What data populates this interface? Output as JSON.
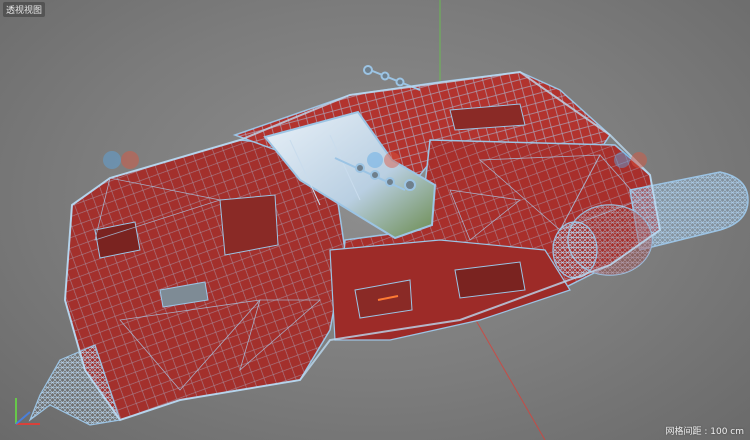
{
  "viewport": {
    "label": "透视视图",
    "grid_spacing": "网格间距 : 100 cm"
  },
  "colors": {
    "background": "#7f7f7f",
    "hull_red": "#a3302c",
    "wire_blue": "#9cc4e4",
    "axis_x": "#d9413a",
    "axis_y": "#67c84a",
    "axis_z": "#4a7fd9"
  },
  "model": {
    "name": "sci-fi vehicle wireframe",
    "shading": "shaded with wireframe"
  }
}
